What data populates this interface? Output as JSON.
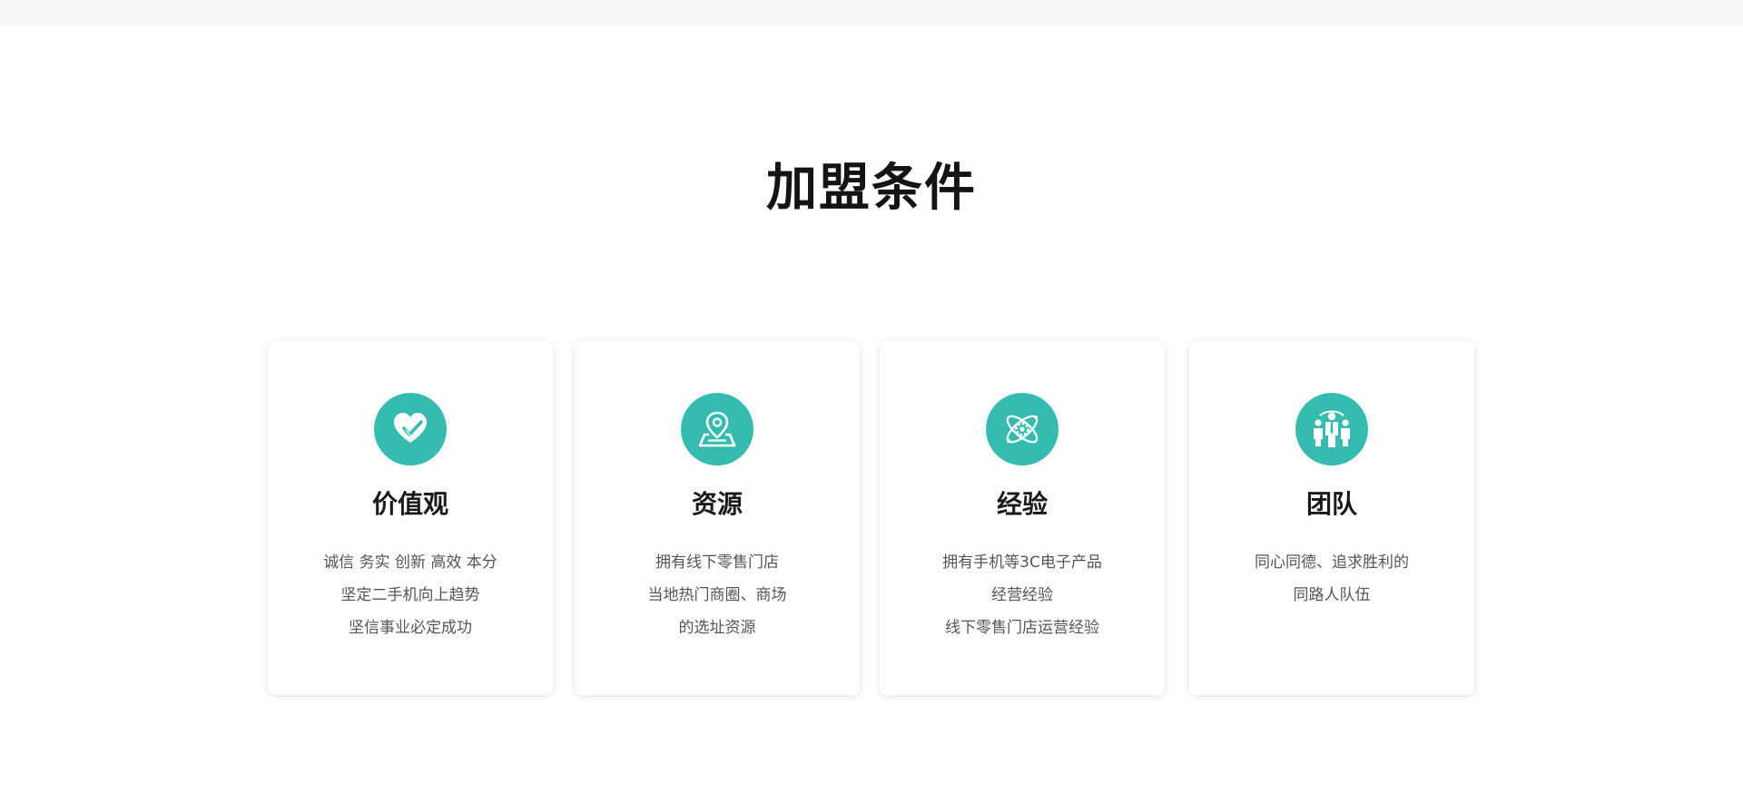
{
  "section": {
    "title": "加盟条件"
  },
  "colors": {
    "accent": "#35bbb0",
    "title": "#141414",
    "text": "#555555"
  },
  "cards": [
    {
      "icon": "heart-check-icon",
      "title": "价值观",
      "lines": [
        "诚信 务实 创新 高效 本分",
        "坚定二手机向上趋势",
        "坚信事业必定成功"
      ]
    },
    {
      "icon": "map-pin-icon",
      "title": "资源",
      "lines": [
        "拥有线下零售门店",
        "当地热门商圈、商场",
        "的选址资源"
      ]
    },
    {
      "icon": "atom-gear-icon",
      "title": "经验",
      "lines": [
        "拥有手机等3C电子产品",
        "经营经验",
        "线下零售门店运营经验"
      ]
    },
    {
      "icon": "team-people-icon",
      "title": "团队",
      "lines": [
        "同心同德、追求胜利的",
        "同路人队伍"
      ]
    }
  ]
}
